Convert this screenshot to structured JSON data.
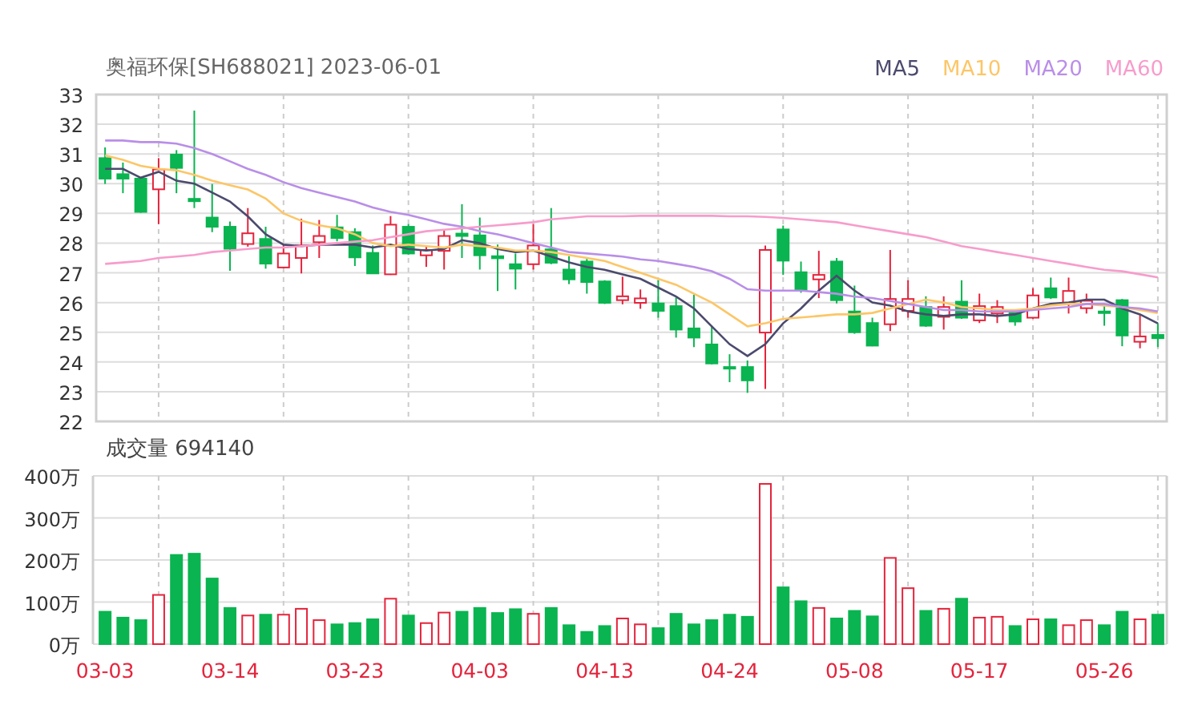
{
  "price_chart": {
    "title": "奥福环保[SH688021] 2023-06-01",
    "chart_data": {
      "type": "candlestick",
      "categories": [
        null,
        null,
        null,
        null,
        null,
        null,
        null,
        null,
        null,
        null,
        null,
        null,
        null,
        null,
        null,
        null,
        null,
        null,
        null,
        null,
        null,
        null,
        null,
        null,
        null,
        null,
        null,
        null,
        null,
        null,
        null,
        null,
        null,
        null,
        null,
        null,
        null,
        null,
        null,
        null,
        null,
        null,
        null,
        null,
        null,
        null,
        null,
        null,
        null,
        null,
        null,
        null,
        null,
        null,
        null,
        null,
        null,
        null,
        null,
        null
      ],
      "grid": true,
      "ylim": [
        22,
        33
      ],
      "yticks": [
        22,
        23,
        24,
        25,
        26,
        27,
        28,
        29,
        30,
        31,
        32,
        33
      ],
      "ohlc": [
        [
          30.86,
          31.22,
          29.99,
          30.17
        ],
        [
          30.32,
          30.71,
          29.68,
          30.17
        ],
        [
          30.17,
          30.2,
          29.02,
          29.05
        ],
        [
          29.81,
          30.86,
          28.64,
          30.48
        ],
        [
          30.98,
          31.13,
          29.68,
          30.53
        ],
        [
          29.49,
          32.46,
          29.18,
          29.41
        ],
        [
          28.86,
          29.99,
          28.37,
          28.55
        ],
        [
          28.55,
          28.73,
          27.07,
          27.81
        ],
        [
          27.97,
          29.18,
          27.88,
          28.33
        ],
        [
          28.14,
          28.55,
          27.14,
          27.31
        ],
        [
          27.18,
          27.95,
          27.16,
          27.65
        ],
        [
          27.5,
          28.82,
          26.98,
          27.92
        ],
        [
          28.03,
          28.78,
          27.5,
          28.24
        ],
        [
          28.53,
          28.95,
          28.06,
          28.17
        ],
        [
          28.37,
          28.5,
          27.23,
          27.52
        ],
        [
          27.67,
          27.92,
          26.96,
          26.98
        ],
        [
          26.95,
          28.91,
          26.93,
          28.62
        ],
        [
          28.55,
          28.64,
          27.61,
          27.65
        ],
        [
          27.59,
          27.88,
          27.2,
          27.77
        ],
        [
          27.74,
          28.46,
          27.11,
          28.24
        ],
        [
          28.32,
          29.31,
          27.5,
          28.24
        ],
        [
          28.26,
          28.86,
          27.11,
          27.59
        ],
        [
          27.56,
          27.95,
          26.39,
          27.49
        ],
        [
          27.29,
          27.65,
          26.44,
          27.14
        ],
        [
          27.29,
          28.64,
          27.11,
          27.92
        ],
        [
          27.79,
          29.18,
          27.29,
          27.34
        ],
        [
          27.11,
          27.56,
          26.62,
          26.78
        ],
        [
          27.38,
          27.47,
          26.3,
          26.69
        ],
        [
          26.71,
          26.75,
          25.95,
          25.99
        ],
        [
          26.08,
          26.87,
          25.94,
          26.21
        ],
        [
          25.99,
          26.44,
          25.79,
          26.14
        ],
        [
          25.97,
          26.75,
          25.49,
          25.72
        ],
        [
          25.88,
          26.17,
          24.82,
          25.09
        ],
        [
          25.13,
          26.26,
          24.5,
          24.82
        ],
        [
          24.59,
          25.22,
          23.92,
          23.95
        ],
        [
          23.83,
          24.26,
          23.32,
          23.79
        ],
        [
          23.83,
          24.05,
          22.96,
          23.38
        ],
        [
          24.99,
          27.92,
          23.09,
          27.77
        ],
        [
          28.46,
          28.59,
          26.93,
          27.41
        ],
        [
          27.02,
          27.38,
          26.33,
          26.42
        ],
        [
          26.78,
          27.74,
          26.15,
          26.93
        ],
        [
          27.38,
          27.5,
          25.97,
          26.08
        ],
        [
          25.7,
          26.57,
          24.95,
          25.0
        ],
        [
          25.31,
          25.49,
          24.53,
          24.55
        ],
        [
          25.27,
          27.77,
          25.04,
          26.12
        ],
        [
          25.72,
          26.75,
          25.49,
          26.12
        ],
        [
          25.85,
          26.21,
          25.18,
          25.22
        ],
        [
          25.52,
          26.21,
          25.09,
          25.85
        ],
        [
          26.03,
          26.75,
          25.45,
          25.49
        ],
        [
          25.4,
          26.3,
          25.31,
          25.88
        ],
        [
          25.63,
          26.08,
          25.31,
          25.85
        ],
        [
          25.7,
          25.76,
          25.22,
          25.36
        ],
        [
          25.49,
          26.48,
          25.45,
          26.24
        ],
        [
          26.48,
          26.84,
          26.12,
          26.17
        ],
        [
          25.99,
          26.84,
          25.63,
          26.39
        ],
        [
          25.81,
          26.3,
          25.63,
          26.06
        ],
        [
          25.7,
          25.97,
          25.22,
          25.65
        ],
        [
          26.08,
          26.12,
          24.53,
          24.89
        ],
        [
          24.68,
          25.58,
          24.46,
          24.86
        ],
        [
          24.91,
          25.31,
          24.5,
          24.8
        ]
      ],
      "series": [
        {
          "type": "line",
          "name": "MA5",
          "color": "#4b4a6e",
          "values": [
            30.5,
            30.5,
            30.2,
            30.4,
            30.1,
            30.0,
            29.7,
            29.4,
            28.9,
            28.3,
            27.95,
            27.9,
            27.95,
            27.95,
            27.95,
            27.85,
            27.95,
            27.8,
            27.75,
            27.8,
            28.1,
            28.0,
            27.8,
            27.7,
            27.75,
            27.55,
            27.35,
            27.2,
            27.1,
            26.95,
            26.8,
            26.5,
            26.2,
            25.8,
            25.2,
            24.6,
            24.2,
            24.6,
            25.3,
            25.8,
            26.4,
            26.9,
            26.4,
            26.0,
            25.9,
            25.7,
            25.6,
            25.55,
            25.6,
            25.6,
            25.55,
            25.6,
            25.8,
            25.95,
            26.0,
            26.1,
            26.1,
            25.8,
            25.6,
            25.3
          ]
        },
        {
          "type": "line",
          "name": "MA10",
          "color": "#fcc667",
          "values": [
            30.95,
            30.8,
            30.6,
            30.5,
            30.45,
            30.3,
            30.1,
            29.95,
            29.8,
            29.5,
            29.0,
            28.75,
            28.6,
            28.5,
            28.3,
            28.0,
            27.9,
            27.95,
            27.9,
            27.85,
            27.95,
            27.9,
            27.85,
            27.75,
            27.75,
            27.7,
            27.6,
            27.5,
            27.4,
            27.2,
            27.0,
            26.8,
            26.6,
            26.3,
            26.0,
            25.6,
            25.2,
            25.3,
            25.45,
            25.5,
            25.55,
            25.6,
            25.6,
            25.65,
            25.8,
            25.95,
            26.1,
            26.0,
            25.85,
            25.8,
            25.75,
            25.75,
            25.8,
            25.9,
            25.95,
            25.95,
            25.9,
            25.85,
            25.75,
            25.65
          ]
        },
        {
          "type": "line",
          "name": "MA20",
          "color": "#b98ee8",
          "values": [
            31.45,
            31.45,
            31.4,
            31.4,
            31.35,
            31.2,
            31.0,
            30.75,
            30.5,
            30.3,
            30.05,
            29.85,
            29.7,
            29.55,
            29.4,
            29.2,
            29.05,
            28.95,
            28.8,
            28.65,
            28.55,
            28.4,
            28.3,
            28.15,
            28.0,
            27.85,
            27.7,
            27.65,
            27.6,
            27.55,
            27.45,
            27.4,
            27.3,
            27.2,
            27.05,
            26.8,
            26.45,
            26.4,
            26.4,
            26.4,
            26.35,
            26.3,
            26.2,
            26.15,
            26.05,
            25.95,
            25.85,
            25.75,
            25.75,
            25.7,
            25.7,
            25.7,
            25.75,
            25.8,
            25.85,
            25.95,
            25.95,
            25.85,
            25.8,
            25.7
          ]
        },
        {
          "type": "line",
          "name": "MA60",
          "color": "#f79ccb",
          "values": [
            27.3,
            27.35,
            27.4,
            27.5,
            27.55,
            27.6,
            27.7,
            27.75,
            27.8,
            27.85,
            27.85,
            27.9,
            27.95,
            28.0,
            28.05,
            28.1,
            28.2,
            28.3,
            28.4,
            28.45,
            28.5,
            28.55,
            28.6,
            28.65,
            28.7,
            28.8,
            28.85,
            28.9,
            28.9,
            28.9,
            28.92,
            28.92,
            28.92,
            28.92,
            28.92,
            28.9,
            28.9,
            28.88,
            28.85,
            28.8,
            28.75,
            28.7,
            28.6,
            28.5,
            28.4,
            28.3,
            28.2,
            28.05,
            27.9,
            27.8,
            27.7,
            27.6,
            27.5,
            27.4,
            27.3,
            27.2,
            27.1,
            27.05,
            26.95,
            26.85
          ]
        }
      ]
    }
  },
  "volume_chart": {
    "title": "成交量 694140",
    "chart_data": {
      "type": "bar",
      "grid": true,
      "categories": [
        "03-03",
        null,
        null,
        null,
        null,
        null,
        null,
        "03-14",
        null,
        null,
        null,
        null,
        null,
        null,
        "03-23",
        null,
        null,
        null,
        null,
        null,
        null,
        "04-03",
        null,
        null,
        null,
        null,
        null,
        null,
        "04-13",
        null,
        null,
        null,
        null,
        null,
        null,
        "04-24",
        null,
        null,
        null,
        null,
        null,
        null,
        "05-08",
        null,
        null,
        null,
        null,
        null,
        null,
        "05-17",
        null,
        null,
        null,
        null,
        null,
        null,
        "05-26",
        null,
        null,
        null
      ],
      "ylim": [
        0,
        400
      ],
      "yticks": [
        {
          "value": 0,
          "label": "0万"
        },
        {
          "value": 100,
          "label": "100万"
        },
        {
          "value": 200,
          "label": "200万"
        },
        {
          "value": 300,
          "label": "300万"
        },
        {
          "value": 400,
          "label": "400万"
        }
      ],
      "values": [
        77,
        63,
        57,
        117,
        212,
        215,
        156,
        86,
        68,
        70,
        70,
        84,
        57,
        47,
        50,
        59,
        108,
        68,
        50,
        75,
        77,
        86,
        74,
        83,
        72,
        86,
        45,
        29,
        43,
        61,
        47,
        38,
        72,
        47,
        57,
        70,
        65,
        381,
        135,
        102,
        86,
        61,
        79,
        66,
        205,
        133,
        79,
        84,
        108,
        63,
        65,
        43,
        59,
        59,
        45,
        57,
        45,
        77,
        59,
        70
      ]
    }
  }
}
